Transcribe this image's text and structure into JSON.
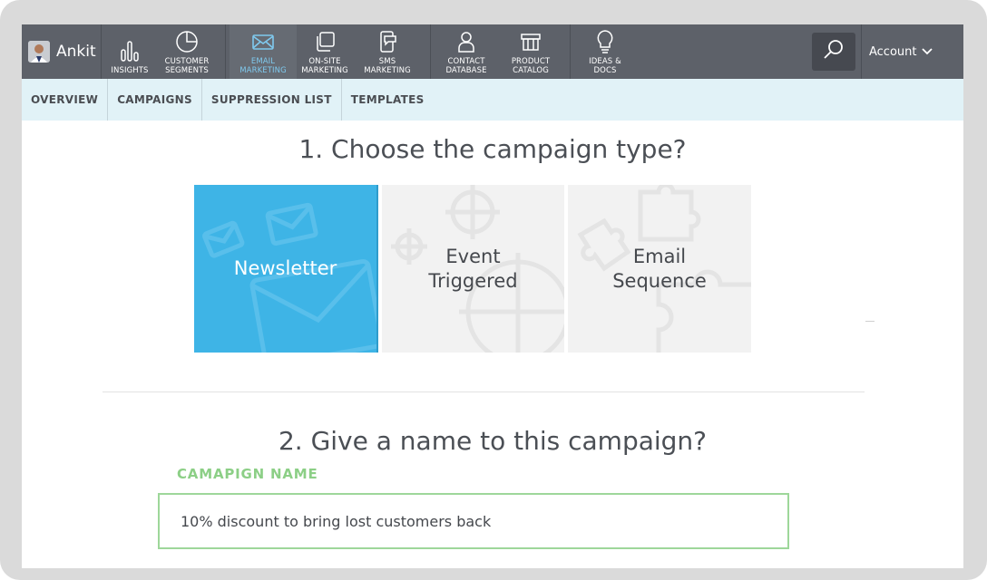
{
  "user": {
    "name": "Ankit"
  },
  "nav": {
    "items": [
      {
        "key": "insights",
        "label": "INSIGHTS",
        "icon": "bar-chart-icon"
      },
      {
        "key": "customer-segments",
        "label": "CUSTOMER\nSEGMENTS",
        "icon": "pie-chart-icon"
      },
      {
        "key": "email-marketing",
        "label": "EMAIL\nMARKETING",
        "icon": "envelope-icon",
        "active": true
      },
      {
        "key": "on-site-marketing",
        "label": "ON-SITE\nMARKETING",
        "icon": "layers-icon"
      },
      {
        "key": "sms-marketing",
        "label": "SMS\nMARKETING",
        "icon": "mobile-icon"
      },
      {
        "key": "contact-database",
        "label": "CONTACT\nDATABASE",
        "icon": "person-icon"
      },
      {
        "key": "product-catalog",
        "label": "PRODUCT\nCATALOG",
        "icon": "box-icon"
      },
      {
        "key": "ideas-docs",
        "label": "IDEAS &\nDOCS",
        "icon": "lightbulb-icon"
      }
    ],
    "account_label": "Account",
    "active_color": "#7fc9ee"
  },
  "subnav": {
    "items": [
      "OVERVIEW",
      "CAMPAIGNS",
      "SUPPRESSION LIST",
      "TEMPLATES"
    ]
  },
  "step1": {
    "question": "1. Choose the campaign type?",
    "cards": [
      {
        "label": "Newsletter",
        "selected": true
      },
      {
        "label": "Event\nTriggered",
        "selected": false
      },
      {
        "label": "Email\nSequence",
        "selected": false
      }
    ]
  },
  "step2": {
    "question": "2. Give a name to this campaign?",
    "field_label": "CAMAPIGN NAME",
    "field_value": "10% discount to bring lost customers back"
  },
  "colors": {
    "topbar": "#5d6169",
    "subnav": "#e1f2f7",
    "selected_card": "#3eb4e6",
    "field_accent": "#8ccf86"
  }
}
